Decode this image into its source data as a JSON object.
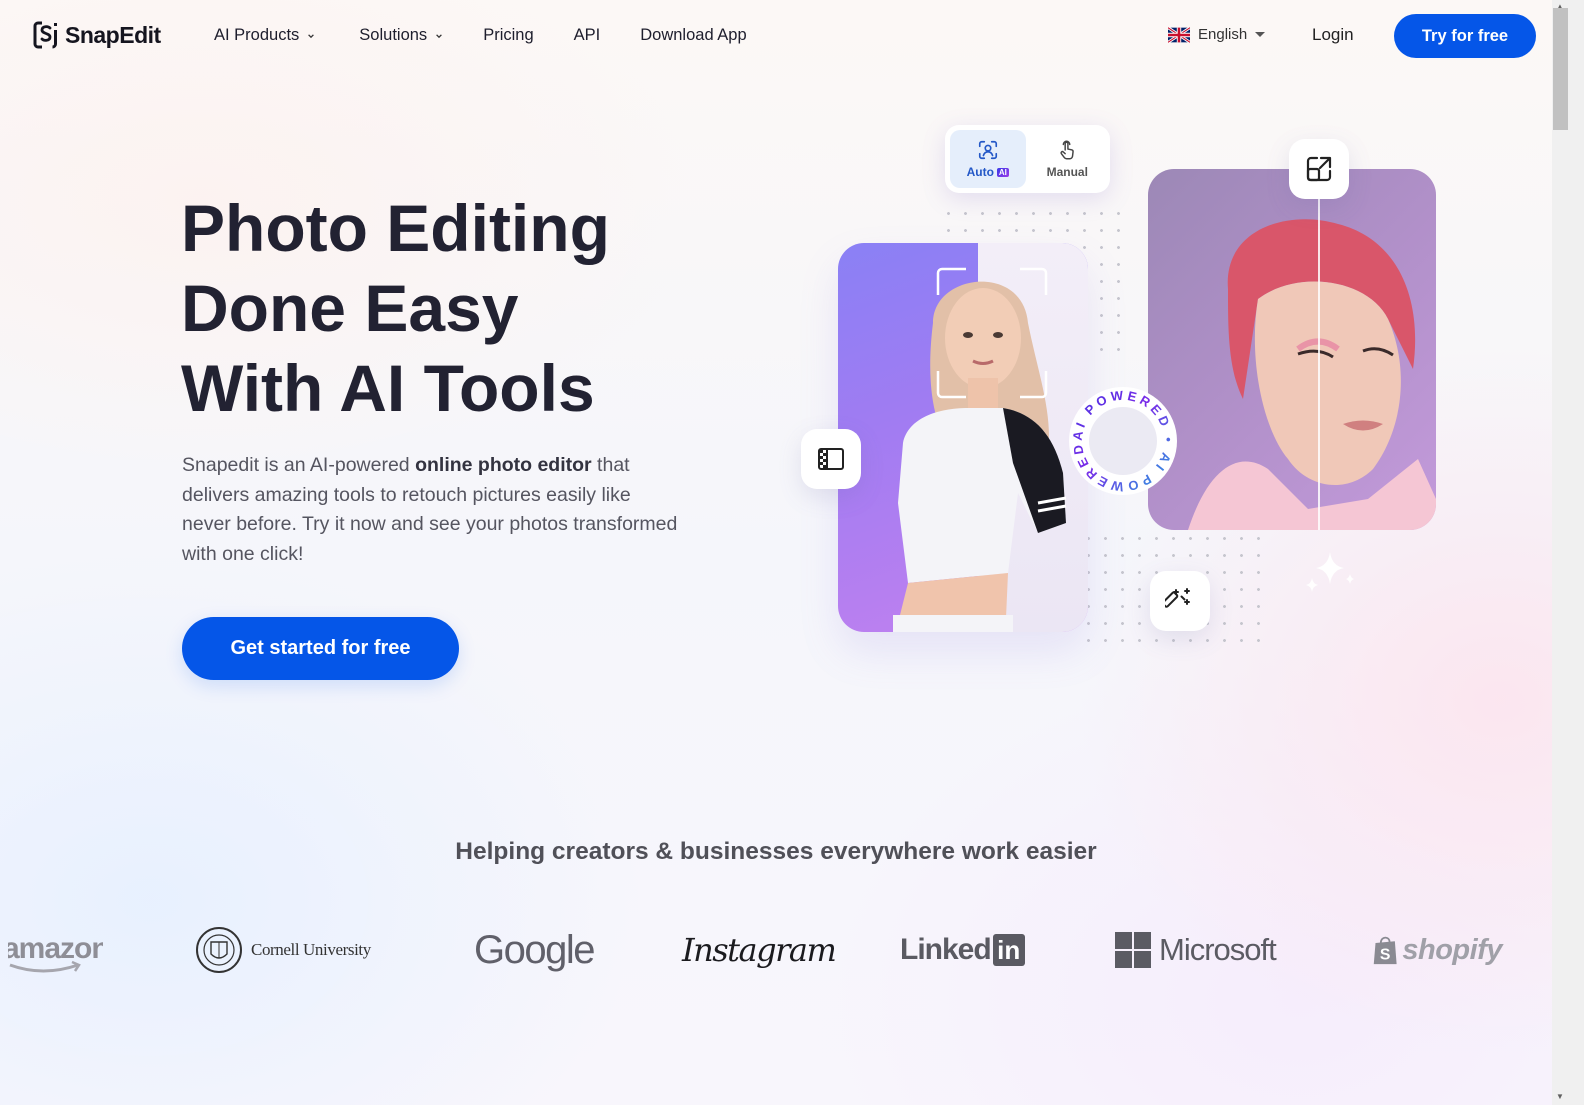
{
  "header": {
    "logo_text": "SnapEdit",
    "nav": [
      {
        "label": "AI Products",
        "has_dropdown": true
      },
      {
        "label": "Solutions",
        "has_dropdown": true
      },
      {
        "label": "Pricing",
        "has_dropdown": false
      },
      {
        "label": "API",
        "has_dropdown": false
      },
      {
        "label": "Download App",
        "has_dropdown": false
      }
    ],
    "language": {
      "label": "English",
      "flag": "uk-flag-icon"
    },
    "login_label": "Login",
    "try_label": "Try for free"
  },
  "hero": {
    "title_lines": [
      "Photo Editing",
      "Done Easy",
      "With AI Tools"
    ],
    "description": {
      "before": "Snapedit is an AI-powered ",
      "bold": "online photo editor",
      "after": " that delivers amazing tools to retouch pictures easily like never before. Try it now and see your photos transformed with one click!"
    },
    "cta_label": "Get started for free"
  },
  "visual": {
    "modes": [
      {
        "label": "Auto",
        "badge": "AI",
        "icon": "face-scan-icon",
        "active": true
      },
      {
        "label": "Manual",
        "icon": "hand-pointer-icon",
        "active": false
      }
    ],
    "ring_text": "AI POWERED • AI POWERED • ",
    "buttons": [
      "background-remove-icon",
      "expand-icon",
      "magic-wand-icon"
    ]
  },
  "trust": {
    "title": "Helping creators & businesses everywhere work easier",
    "brands": [
      "amazon",
      "Cornell University",
      "Google",
      "Instagram",
      "Linked",
      "Microsoft",
      "shopify"
    ]
  },
  "colors": {
    "primary": "#0556e8",
    "heading": "#222232",
    "body_text": "#555560"
  }
}
